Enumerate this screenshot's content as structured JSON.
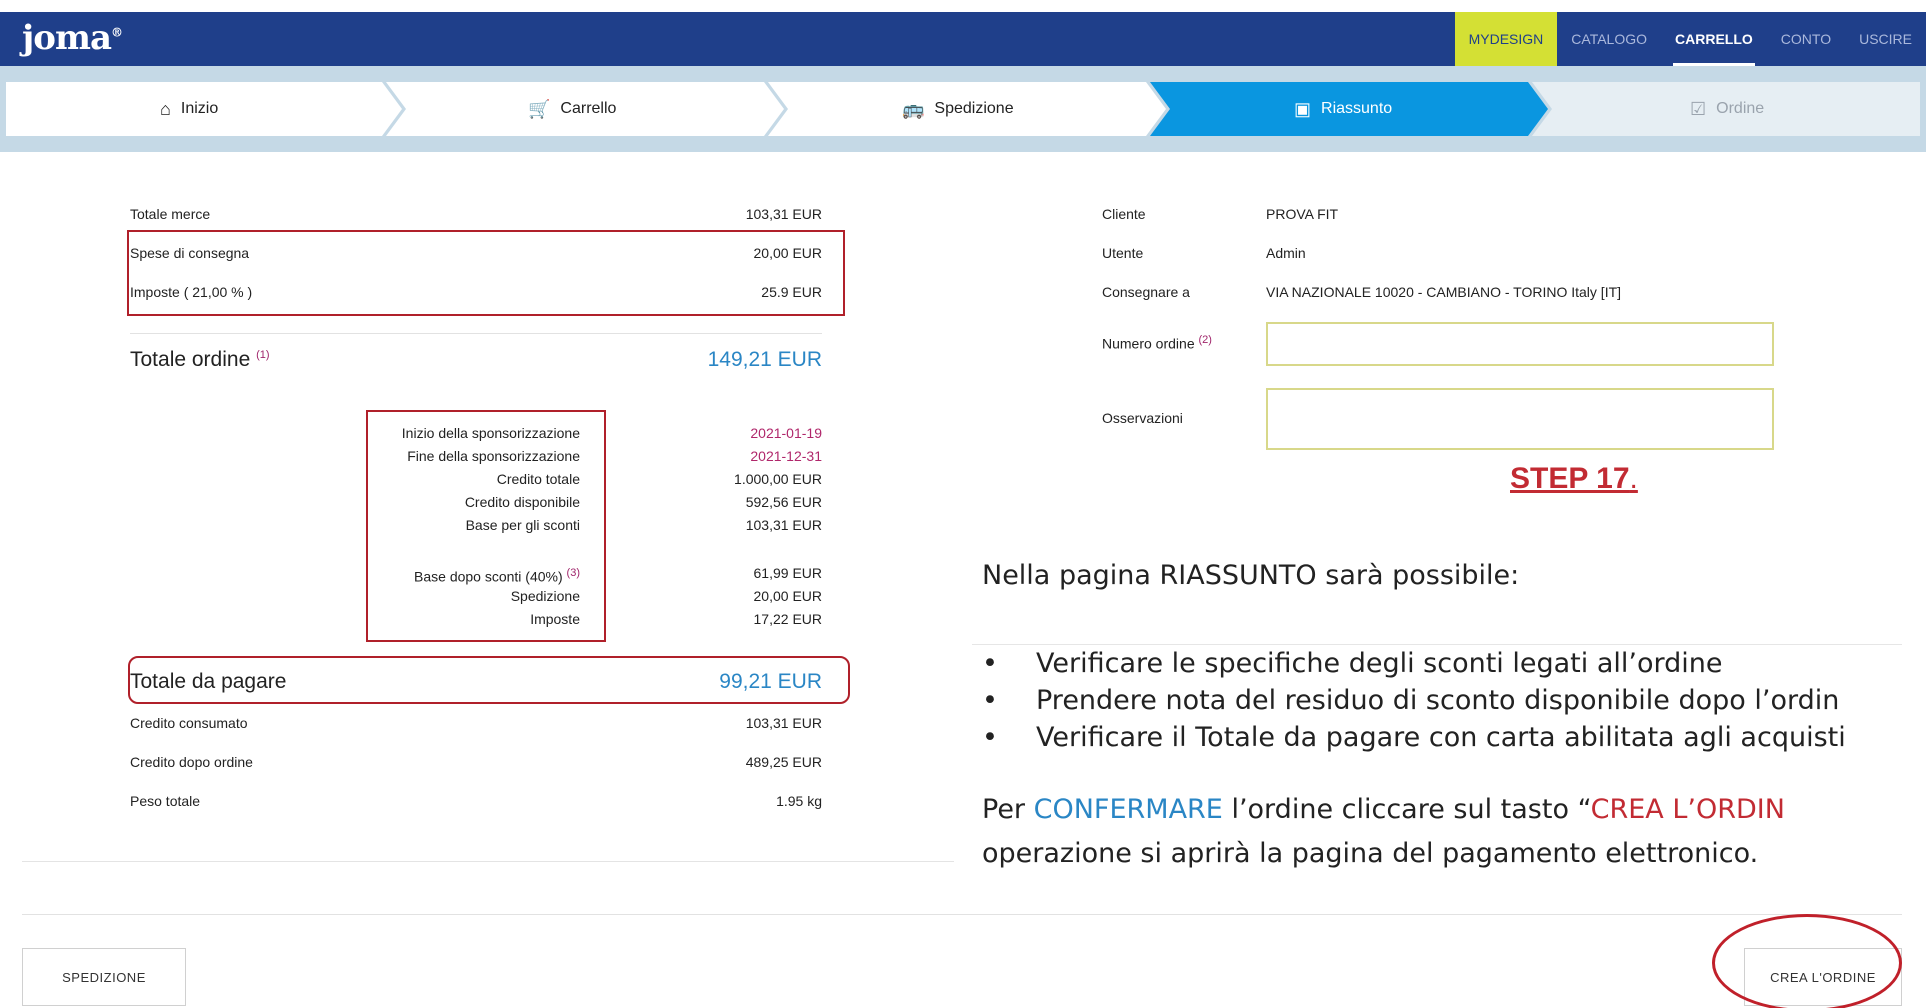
{
  "brand": {
    "logo": "joma",
    "logo_mark": "®"
  },
  "topnav": {
    "items": [
      "MYDESIGN",
      "CATALOGO",
      "CARRELLO",
      "CONTO",
      "USCIRE"
    ]
  },
  "steps": [
    {
      "label": "Inizio",
      "icon": "home-icon",
      "glyph": "⌂"
    },
    {
      "label": "Carrello",
      "icon": "cart-icon",
      "glyph": "🛒"
    },
    {
      "label": "Spedizione",
      "icon": "bus-icon",
      "glyph": "🚌"
    },
    {
      "label": "Riassunto",
      "icon": "summary-icon",
      "glyph": "▣"
    },
    {
      "label": "Ordine",
      "icon": "order-check-icon",
      "glyph": "☑"
    }
  ],
  "summary": {
    "totale_merce": {
      "label": "Totale merce",
      "value": "103,31 EUR"
    },
    "spese_consegna": {
      "label": "Spese di consegna",
      "value": "20,00 EUR"
    },
    "imposte": {
      "label": "Imposte ( 21,00 % )",
      "value": "25.9 EUR"
    },
    "totale_ordine": {
      "label": "Totale ordine",
      "note": "(1)",
      "value": "149,21 EUR"
    },
    "details": [
      {
        "label": "Inizio della sponsorizzazione",
        "value": "2021-01-19"
      },
      {
        "label": "Fine della sponsorizzazione",
        "value": "2021-12-31"
      },
      {
        "label": "Credito totale",
        "value": "1.000,00 EUR"
      },
      {
        "label": "Credito disponibile",
        "value": "592,56 EUR"
      },
      {
        "label": "Base per gli sconti",
        "value": "103,31 EUR"
      },
      {
        "label": "Base dopo sconti (40%)",
        "note": "(3)",
        "value": "61,99 EUR"
      },
      {
        "label": "Spedizione",
        "value": "20,00 EUR"
      },
      {
        "label": "Imposte",
        "value": "17,22 EUR"
      }
    ],
    "totale_da_pagare": {
      "label": "Totale da pagare",
      "value": "99,21 EUR"
    },
    "credito_consumato": {
      "label": "Credito consumato",
      "value": "103,31 EUR"
    },
    "credito_dopo_ordine": {
      "label": "Credito dopo ordine",
      "value": "489,25 EUR"
    },
    "peso_totale": {
      "label": "Peso totale",
      "value": "1.95 kg"
    }
  },
  "customer": {
    "cliente_label": "Cliente",
    "cliente_value": "PROVA FIT",
    "utente_label": "Utente",
    "utente_value": "Admin",
    "consegnare_label": "Consegnare a",
    "consegnare_value": "VIA NAZIONALE 10020 - CAMBIANO - TORINO Italy [IT]",
    "numero_label": "Numero ordine",
    "numero_note": "(2)",
    "numero_value": "",
    "osservazioni_label": "Osservazioni",
    "osservazioni_value": ""
  },
  "annotation": {
    "step": "STEP 17",
    "step_suffix": ".",
    "intro": "Nella pagina RIASSUNTO sarà possibile:",
    "bullets": [
      "Verificare le specifiche degli sconti legati all’ordine",
      "Prendere nota del residuo di sconto disponibile dopo l’ordin",
      "Verificare il Totale da pagare con carta abilitata agli acquisti"
    ],
    "confirm_pre": "Per ",
    "confirm_word": "CONFERMARE",
    "confirm_mid": " l’ordine  cliccare  sul  tasto  “",
    "confirm_button_word": "CREA  L’ORDIN",
    "line2": "operazione si aprirà la pagina del pagamento elettronico."
  },
  "buttons": {
    "back": "SPEDIZIONE",
    "create": "CREA L'ORDINE"
  },
  "colors": {
    "nav": "#1f3f8a",
    "mydesign": "#d4e034",
    "active_step": "#0a96e0",
    "accent": "#2a86c5",
    "highlight": "#b0202a"
  }
}
